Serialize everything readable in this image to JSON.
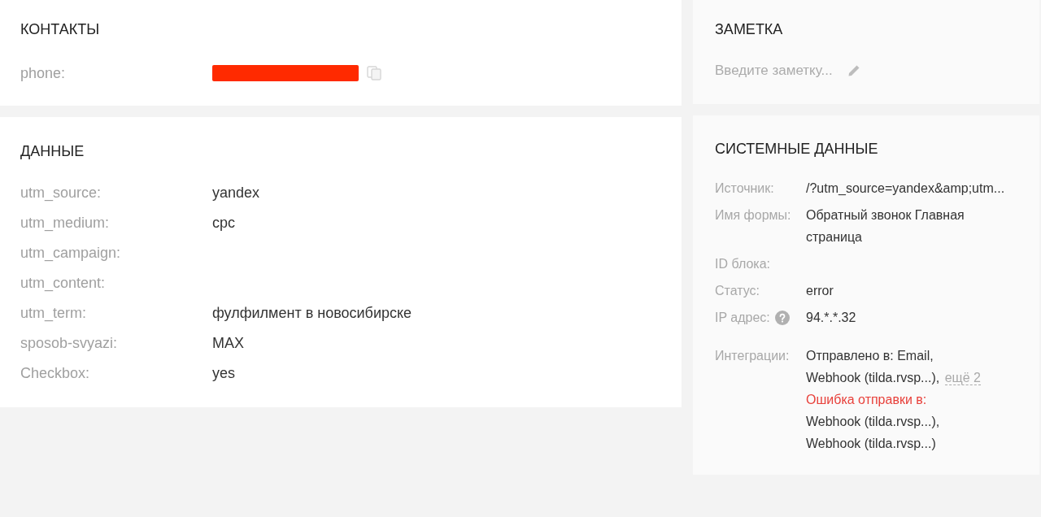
{
  "contacts": {
    "title": "КОНТАКТЫ",
    "fields": [
      {
        "label": "phone:",
        "redacted": true,
        "copyable": true
      }
    ]
  },
  "data": {
    "title": "ДАННЫЕ",
    "fields": [
      {
        "label": "utm_source:",
        "value": "yandex"
      },
      {
        "label": "utm_medium:",
        "value": "cpc"
      },
      {
        "label": "utm_campaign:"
      },
      {
        "label": "utm_content:"
      },
      {
        "label": "utm_term:",
        "value": "фулфилмент в новосибирске"
      },
      {
        "label": "sposob-svyazi:",
        "value": "MAX"
      },
      {
        "label": "Checkbox:",
        "value": "yes"
      }
    ]
  },
  "note": {
    "title": "ЗАМЕТКА",
    "placeholder": "Введите заметку..."
  },
  "system": {
    "title": "СИСТЕМНЫЕ ДАННЫЕ",
    "fields": [
      {
        "label": "Источник:",
        "value": "/?utm_source=yandex&amp;utm..."
      },
      {
        "label": "Имя формы:",
        "value": "Обратный звонок Главная страница"
      },
      {
        "label": "ID блока:"
      },
      {
        "label": "Статус:",
        "value": "error"
      },
      {
        "label": "IP адрес:",
        "value": "94.*.*.32",
        "help": true
      }
    ],
    "integrations": {
      "label": "Интеграции:",
      "sent": {
        "label": "Отправлено в:",
        "targets": [
          "Email,",
          "Webhook (tilda.rvsp...),"
        ]
      },
      "more": "ещё 2",
      "failed": {
        "label": "Ошибка отправки в:",
        "targets": [
          "Webhook (tilda.rvsp...),",
          "Webhook (tilda.rvsp...)"
        ]
      }
    }
  }
}
